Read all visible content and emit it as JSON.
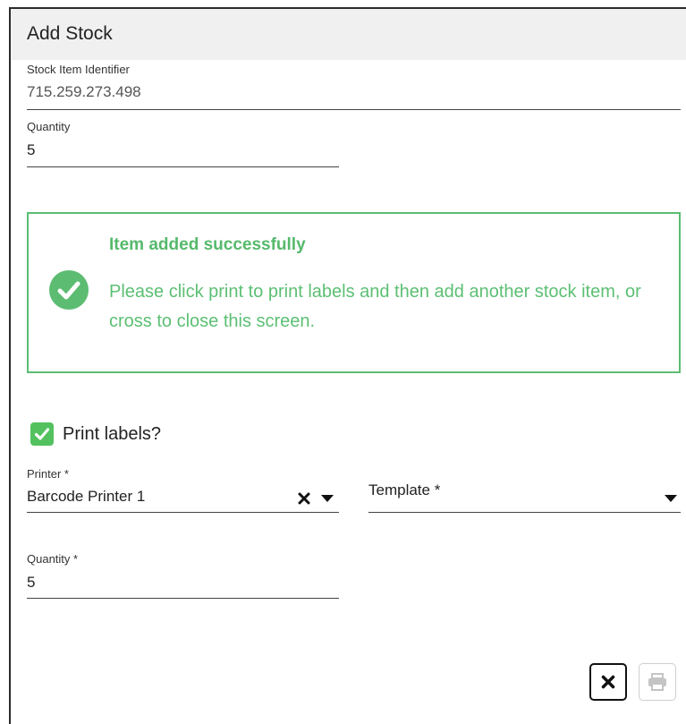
{
  "dialog": {
    "title": "Add Stock"
  },
  "stock_item": {
    "label": "Stock Item Identifier",
    "value": "715.259.273.498"
  },
  "quantity_top": {
    "label": "Quantity",
    "value": "5"
  },
  "alert": {
    "title": "Item added successfully",
    "message": "Please click print to print labels and then add another stock item, or cross to close this screen.",
    "color": "#5cbc72",
    "icon": "check-circle-icon"
  },
  "print_labels": {
    "label": "Print labels?",
    "checked": true,
    "color": "#52c15e"
  },
  "printer": {
    "label": "Printer *",
    "value": "Barcode Printer 1",
    "clear_icon": "close-icon",
    "dropdown_icon": "caret-down-icon"
  },
  "template": {
    "label": "Template *",
    "value": "",
    "dropdown_icon": "caret-down-icon"
  },
  "quantity_print": {
    "label": "Quantity *",
    "value": "5"
  },
  "actions": {
    "close_icon": "close-icon",
    "print_icon": "printer-icon",
    "print_disabled": true
  }
}
